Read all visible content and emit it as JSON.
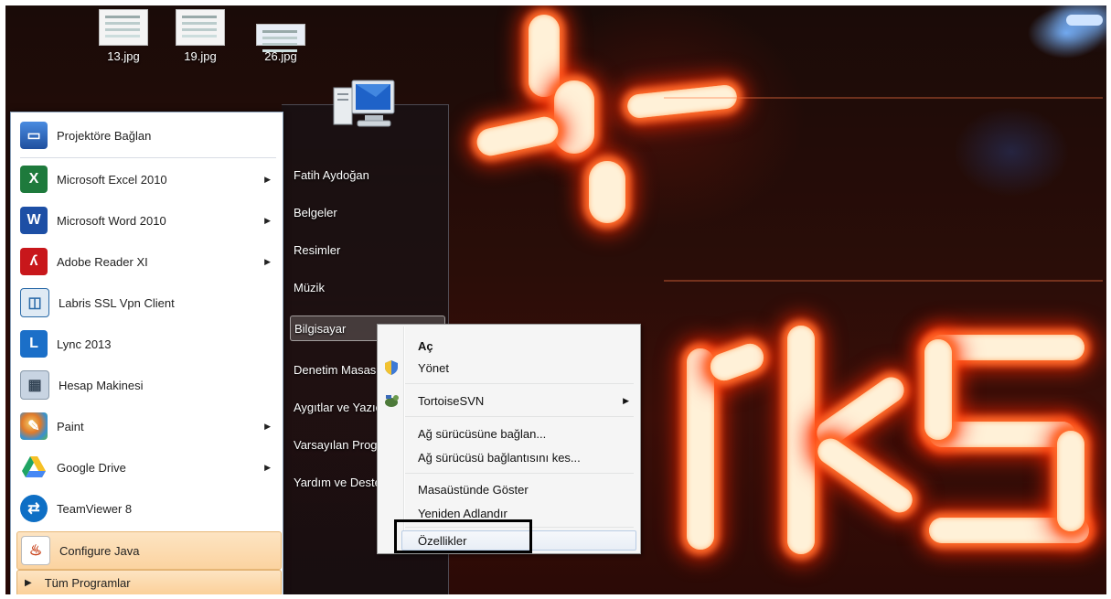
{
  "desktop": {
    "icons": [
      {
        "label": "13.jpg"
      },
      {
        "label": "19.jpg"
      },
      {
        "label": "26.jpg"
      }
    ]
  },
  "start_menu": {
    "left_items": [
      {
        "label": "Projektöre Bağlan",
        "icon": "projector-icon",
        "has_arrow": false
      },
      {
        "label": "Microsoft Excel 2010",
        "icon": "excel-icon",
        "has_arrow": true
      },
      {
        "label": "Microsoft Word 2010",
        "icon": "word-icon",
        "has_arrow": true
      },
      {
        "label": "Adobe Reader XI",
        "icon": "adobe-reader-icon",
        "has_arrow": true
      },
      {
        "label": "Labris SSL Vpn Client",
        "icon": "vpn-icon",
        "has_arrow": false
      },
      {
        "label": "Lync 2013",
        "icon": "lync-icon",
        "has_arrow": false
      },
      {
        "label": "Hesap Makinesi",
        "icon": "calculator-icon",
        "has_arrow": false
      },
      {
        "label": "Paint",
        "icon": "paint-icon",
        "has_arrow": true
      },
      {
        "label": "Google Drive",
        "icon": "google-drive-icon",
        "has_arrow": true
      },
      {
        "label": "TeamViewer 8",
        "icon": "teamviewer-icon",
        "has_arrow": false
      },
      {
        "label": "Configure Java",
        "icon": "java-icon",
        "has_arrow": false,
        "highlighted": true
      }
    ],
    "all_programs": "Tüm Programlar",
    "right_items": [
      {
        "label": "Fatih Aydoğan"
      },
      {
        "label": "Belgeler"
      },
      {
        "label": "Resimler"
      },
      {
        "label": "Müzik"
      },
      {
        "label": "Bilgisayar",
        "highlighted": true
      },
      {
        "label": "Denetim Masası"
      },
      {
        "label": "Aygıtlar ve Yazıcılar"
      },
      {
        "label": "Varsayılan Programlar"
      },
      {
        "label": "Yardım ve Destek"
      }
    ]
  },
  "context_menu": {
    "items": [
      {
        "label": "Aç",
        "bold": true
      },
      {
        "label": "Yönet",
        "icon": "shield-icon"
      },
      {
        "label": "TortoiseSVN",
        "icon": "tortoisesvn-icon",
        "has_arrow": true
      },
      {
        "label": "Ağ sürücüsüne bağlan..."
      },
      {
        "label": "Ağ sürücüsü bağlantısını kes..."
      },
      {
        "label": "Masaüstünde Göster"
      },
      {
        "label": "Yeniden Adlandır"
      },
      {
        "label": "Özellikler",
        "highlighted": true,
        "outlined": true
      }
    ]
  },
  "colors": {
    "highlight": "#fbd3a0",
    "annotation_outline": "#000000"
  }
}
